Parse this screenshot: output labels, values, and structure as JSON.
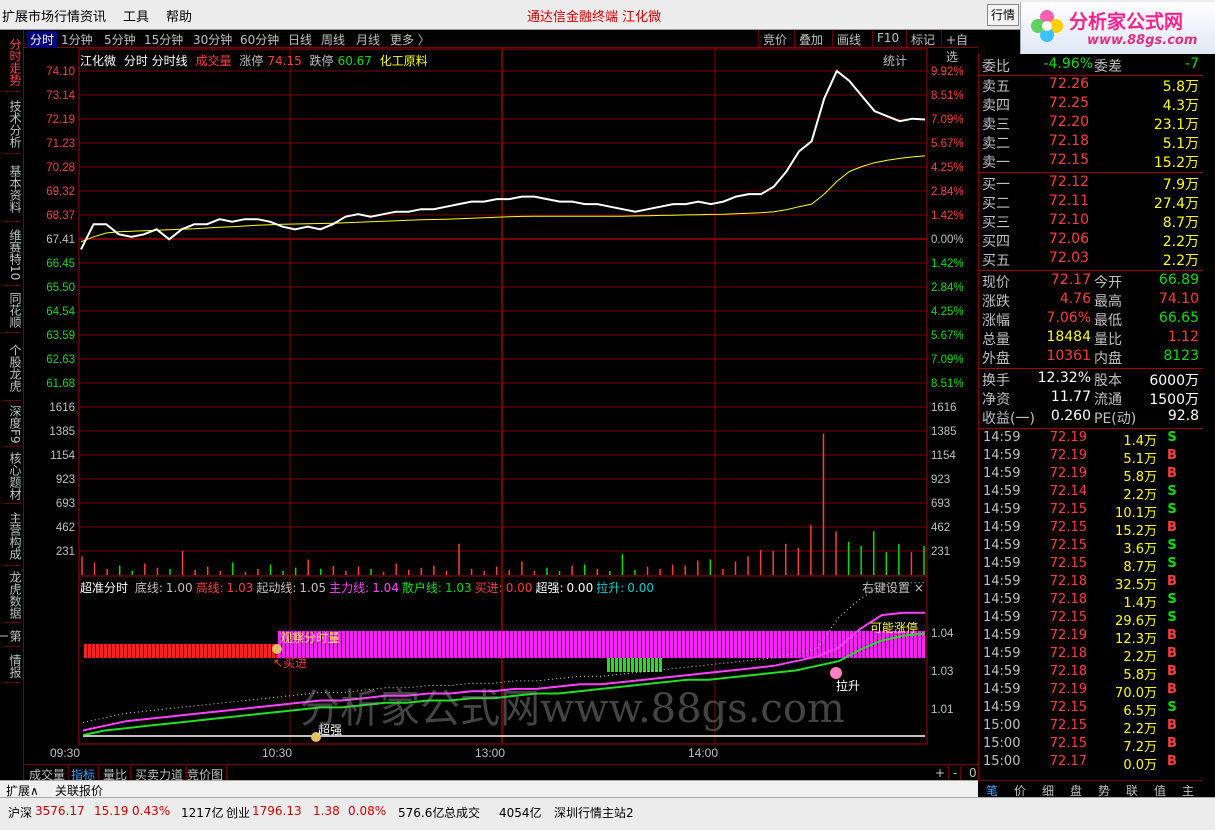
{
  "menu": {
    "items": [
      "扩展市场行情",
      "资讯",
      "工具",
      "帮助"
    ],
    "title": "通达信金融终端   江化微",
    "right_button": "行情"
  },
  "logo": {
    "brand": "分析家公式网",
    "url": "www.88gs.com"
  },
  "toolbar": {
    "periods": [
      "分时",
      "1分钟",
      "5分钟",
      "15分钟",
      "30分钟",
      "60分钟",
      "日线",
      "周线",
      "月线",
      "更多 〉"
    ],
    "right": [
      "竞价",
      "叠加",
      "画线",
      "F10",
      "标记",
      "+自选"
    ]
  },
  "left_tabs": [
    "分时走势",
    "技术分析",
    "基本资料",
    "维赛特10",
    "同花顺",
    "个股龙虎",
    "深度F9",
    "核心题材",
    "主营构成",
    "龙虎数据",
    "第一",
    "情报"
  ],
  "chart_header": {
    "name": "江化微",
    "mode": "分时 分时线",
    "vol": "成交量",
    "zt_label": "涨停",
    "zt_value": "74.15",
    "dt_label": "跌停",
    "dt_value": "60.67",
    "sector": "化工原料",
    "stat": "统计"
  },
  "indicator_header": {
    "name": "超准分时",
    "items": [
      {
        "label": "底线:",
        "value": "1.00",
        "color": "#c0c0c0"
      },
      {
        "label": "高线:",
        "value": "1.03",
        "color": "#ff3b3b"
      },
      {
        "label": "起动线:",
        "value": "1.05",
        "color": "#c0c0c0"
      },
      {
        "label": "主力线:",
        "value": "1.04",
        "color": "#ff40ff"
      },
      {
        "label": "散户线:",
        "value": "1.03",
        "color": "#00e000"
      },
      {
        "label": "买进:",
        "value": "0.00",
        "color": "#ff3b3b"
      },
      {
        "label": "超强:",
        "value": "0.00",
        "color": "#ffffff"
      },
      {
        "label": "拉升:",
        "value": "0.00",
        "color": "#00d0d0"
      }
    ],
    "setting": "右键设置  ×"
  },
  "indicator_annotations": {
    "observe": "观察分时量",
    "buy": "买进",
    "strong": "超强",
    "maybe_limit": "可能涨停",
    "lift": "拉升"
  },
  "watermark": "分析家公式网www.88gs.com",
  "price_axis": {
    "left": [
      "74.10",
      "73.14",
      "72.19",
      "71.23",
      "70.28",
      "69.32",
      "68.37",
      "67.41",
      "66.45",
      "65.50",
      "64.54",
      "63.59",
      "62.63",
      "61.68"
    ],
    "right": [
      "9.92%",
      "8.51%",
      "7.09%",
      "5.67%",
      "4.25%",
      "2.84%",
      "1.42%",
      "0.00%",
      "1.42%",
      "2.84%",
      "4.25%",
      "5.67%",
      "7.09%",
      "8.51%"
    ]
  },
  "volume_axis": [
    "1616",
    "1385",
    "1154",
    "923",
    "693",
    "462",
    "231"
  ],
  "indicator_axis": [
    "1.04",
    "1.03",
    "1.01"
  ],
  "time_axis": [
    "09:30",
    "10:30",
    "13:00",
    "14:00"
  ],
  "bottom_tabs": [
    "成交量",
    "指标",
    "量比",
    "买卖力道",
    "竞价图"
  ],
  "bottom_right": [
    "+",
    "-",
    "0"
  ],
  "expand_bar": [
    "扩展∧",
    "关联报价"
  ],
  "status": {
    "hs_label": "沪深",
    "hs_value": "3576.17",
    "hs_chg": "15.19",
    "hs_pct": "0.43%",
    "hs_amt": "1217亿",
    "cy_label": "创业",
    "cy_value": "1796.13",
    "cy_chg": "1.38",
    "cy_pct": "0.08%",
    "cy_amt": "576.6亿",
    "total_label": "总成交",
    "total_value": "4054亿",
    "server": "深圳行情主站2"
  },
  "order_book": {
    "weibi_label": "委比",
    "weibi_value": "-4.96%",
    "weicha_label": "委差",
    "weicha_value": "-7",
    "sells": [
      {
        "label": "卖五",
        "price": "72.26",
        "vol": "5.8万"
      },
      {
        "label": "卖四",
        "price": "72.25",
        "vol": "4.3万"
      },
      {
        "label": "卖三",
        "price": "72.20",
        "vol": "23.1万"
      },
      {
        "label": "卖二",
        "price": "72.18",
        "vol": "5.1万"
      },
      {
        "label": "卖一",
        "price": "72.15",
        "vol": "15.2万"
      }
    ],
    "buys": [
      {
        "label": "买一",
        "price": "72.12",
        "vol": "7.9万"
      },
      {
        "label": "买二",
        "price": "72.11",
        "vol": "27.4万"
      },
      {
        "label": "买三",
        "price": "72.10",
        "vol": "8.7万"
      },
      {
        "label": "买四",
        "price": "72.06",
        "vol": "2.2万"
      },
      {
        "label": "买五",
        "price": "72.03",
        "vol": "2.2万"
      }
    ]
  },
  "quote": [
    {
      "l1": "现价",
      "v1": "72.17",
      "c1": "#ff3b3b",
      "l2": "今开",
      "v2": "66.89",
      "c2": "#00e000"
    },
    {
      "l1": "涨跌",
      "v1": "4.76",
      "c1": "#ff3b3b",
      "l2": "最高",
      "v2": "74.10",
      "c2": "#ff3b3b"
    },
    {
      "l1": "涨幅",
      "v1": "7.06%",
      "c1": "#ff3b3b",
      "l2": "最低",
      "v2": "66.65",
      "c2": "#00e000"
    },
    {
      "l1": "总量",
      "v1": "18484",
      "c1": "#ffff00",
      "l2": "量比",
      "v2": "1.12",
      "c2": "#ff3b3b"
    },
    {
      "l1": "外盘",
      "v1": "10361",
      "c1": "#ff3b3b",
      "l2": "内盘",
      "v2": "8123",
      "c2": "#00e000"
    }
  ],
  "fundamentals": [
    {
      "l1": "换手",
      "v1": "12.32%",
      "l2": "股本",
      "v2": "6000万"
    },
    {
      "l1": "净资",
      "v1": "11.77",
      "l2": "流通",
      "v2": "1500万"
    },
    {
      "l1": "收益(一)",
      "v1": "0.260",
      "l2": "PE(动)",
      "v2": "92.8"
    }
  ],
  "ticks": [
    {
      "t": "14:59",
      "p": "72.19",
      "v": "1.4万",
      "s": "S"
    },
    {
      "t": "14:59",
      "p": "72.19",
      "v": "5.1万",
      "s": "B"
    },
    {
      "t": "14:59",
      "p": "72.19",
      "v": "5.8万",
      "s": "B"
    },
    {
      "t": "14:59",
      "p": "72.14",
      "v": "2.2万",
      "s": "S"
    },
    {
      "t": "14:59",
      "p": "72.15",
      "v": "10.1万",
      "s": "S"
    },
    {
      "t": "14:59",
      "p": "72.15",
      "v": "15.2万",
      "s": "B"
    },
    {
      "t": "14:59",
      "p": "72.15",
      "v": "3.6万",
      "s": "S"
    },
    {
      "t": "14:59",
      "p": "72.15",
      "v": "8.7万",
      "s": "S"
    },
    {
      "t": "14:59",
      "p": "72.18",
      "v": "32.5万",
      "s": "B"
    },
    {
      "t": "14:59",
      "p": "72.18",
      "v": "1.4万",
      "s": "S"
    },
    {
      "t": "14:59",
      "p": "72.15",
      "v": "29.6万",
      "s": "S"
    },
    {
      "t": "14:59",
      "p": "72.19",
      "v": "12.3万",
      "s": "B"
    },
    {
      "t": "14:59",
      "p": "72.18",
      "v": "2.2万",
      "s": "B"
    },
    {
      "t": "14:59",
      "p": "72.18",
      "v": "5.8万",
      "s": "B"
    },
    {
      "t": "14:59",
      "p": "72.19",
      "v": "70.0万",
      "s": "B"
    },
    {
      "t": "14:59",
      "p": "72.15",
      "v": "6.5万",
      "s": "S"
    },
    {
      "t": "15:00",
      "p": "72.15",
      "v": "2.2万",
      "s": "B"
    },
    {
      "t": "15:00",
      "p": "72.15",
      "v": "7.2万",
      "s": "B"
    },
    {
      "t": "15:00",
      "p": "72.17",
      "v": "0.0万",
      "s": "B"
    }
  ],
  "right_tabs": [
    "笔",
    "价",
    "细",
    "盘",
    "势",
    "联",
    "值",
    "主"
  ],
  "colors": {
    "up": "#ff3b3b",
    "down": "#00e000",
    "grid": "#a00000",
    "price_line": "#ffffff",
    "avg_line": "#ffff00"
  },
  "chart_data": {
    "type": "line",
    "prev_close": 67.41,
    "ylim": [
      60.67,
      74.15
    ],
    "price": [
      67.0,
      68.0,
      68.0,
      67.6,
      67.5,
      67.6,
      67.8,
      67.4,
      67.8,
      68.0,
      68.0,
      68.2,
      68.1,
      68.2,
      68.2,
      68.1,
      67.9,
      67.8,
      67.9,
      67.8,
      68.0,
      68.3,
      68.4,
      68.3,
      68.4,
      68.5,
      68.5,
      68.6,
      68.6,
      68.7,
      68.8,
      68.9,
      68.9,
      69.0,
      69.0,
      69.1,
      69.1,
      69.0,
      68.9,
      68.9,
      68.8,
      68.8,
      68.7,
      68.6,
      68.5,
      68.6,
      68.7,
      68.8,
      68.8,
      68.9,
      68.8,
      68.9,
      69.1,
      69.2,
      69.2,
      69.5,
      70.1,
      70.9,
      71.3,
      73.0,
      74.1,
      73.7,
      73.1,
      72.5,
      72.3,
      72.1,
      72.2,
      72.17
    ],
    "avg": [
      67.3,
      67.5,
      67.65,
      67.7,
      67.72,
      67.74,
      67.76,
      67.78,
      67.8,
      67.82,
      67.85,
      67.88,
      67.9,
      67.93,
      67.96,
      67.98,
      68.0,
      68.01,
      68.02,
      68.03,
      68.04,
      68.06,
      68.08,
      68.1,
      68.12,
      68.14,
      68.16,
      68.18,
      68.19,
      68.2,
      68.22,
      68.24,
      68.26,
      68.28,
      68.3,
      68.31,
      68.32,
      68.32,
      68.32,
      68.32,
      68.32,
      68.32,
      68.32,
      68.32,
      68.33,
      68.34,
      68.35,
      68.36,
      68.37,
      68.38,
      68.39,
      68.4,
      68.42,
      68.44,
      68.46,
      68.5,
      68.58,
      68.7,
      68.8,
      69.2,
      69.7,
      70.1,
      70.3,
      70.45,
      70.55,
      70.62,
      70.68,
      70.72
    ],
    "volume": [
      180,
      120,
      60,
      90,
      40,
      110,
      70,
      60,
      230,
      50,
      80,
      40,
      120,
      30,
      60,
      100,
      40,
      70,
      150,
      60,
      90,
      40,
      80,
      60,
      30,
      110,
      50,
      70,
      90,
      40,
      300,
      60,
      40,
      80,
      50,
      130,
      40,
      70,
      40,
      90,
      100,
      60,
      40,
      200,
      50,
      80,
      60,
      100,
      90,
      140,
      150,
      60,
      130,
      180,
      240,
      230,
      300,
      260,
      480,
      1360,
      420,
      320,
      280,
      420,
      220,
      300,
      220,
      280
    ],
    "vol_ylim": [
      0,
      1616
    ],
    "main_line": [
      0.99,
      0.992,
      0.994,
      0.995,
      0.996,
      0.997,
      0.998,
      0.999,
      1.0,
      1.001,
      1.002,
      1.003,
      1.003,
      1.004,
      1.005,
      1.005,
      1.006,
      1.006,
      1.007,
      1.007,
      1.008,
      1.008,
      1.009,
      1.01,
      1.01,
      1.011,
      1.012,
      1.013,
      1.014,
      1.015,
      1.016,
      1.017,
      1.018,
      1.02,
      1.022,
      1.026,
      1.034,
      1.04,
      1.041,
      1.041
    ],
    "retail_line": [
      0.988,
      0.99,
      0.991,
      0.992,
      0.993,
      0.994,
      0.995,
      0.996,
      0.997,
      0.998,
      0.999,
      1.0,
      1.0,
      1.001,
      1.002,
      1.002,
      1.003,
      1.003,
      1.004,
      1.004,
      1.005,
      1.006,
      1.006,
      1.007,
      1.008,
      1.009,
      1.01,
      1.011,
      1.012,
      1.012,
      1.013,
      1.014,
      1.015,
      1.016,
      1.018,
      1.02,
      1.025,
      1.029,
      1.031,
      1.032
    ],
    "ind_ylim": [
      0.985,
      1.05
    ]
  }
}
